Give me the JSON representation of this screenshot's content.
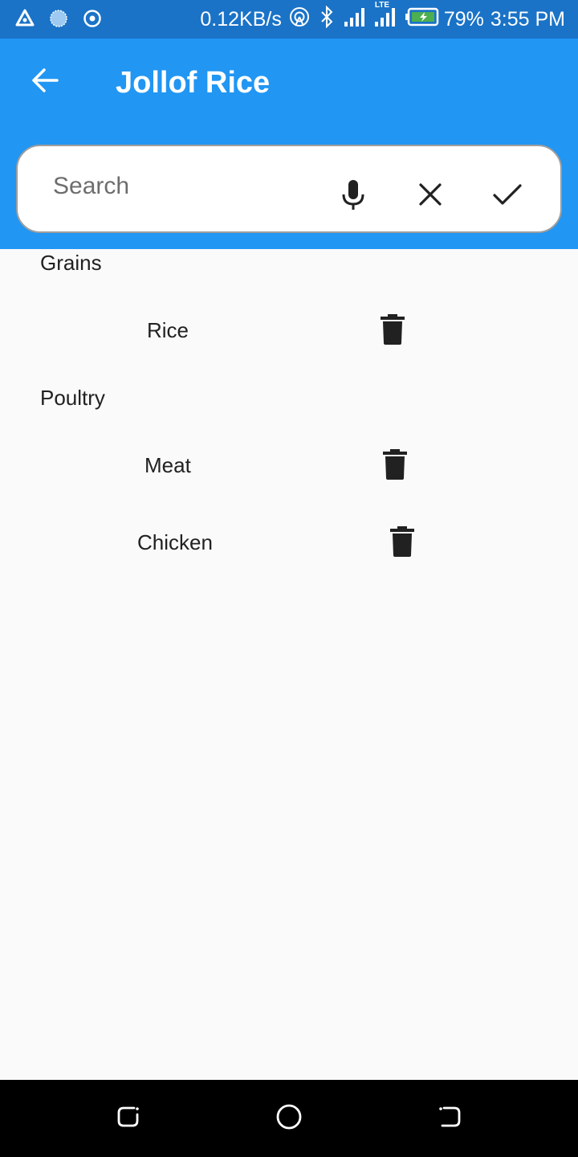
{
  "status_bar": {
    "net_speed": "0.12KB/s",
    "network_type": "LTE",
    "battery": "79%",
    "time": "3:55 PM",
    "icons": [
      "navigation-icon",
      "weather-icon",
      "radar-icon",
      "hotspot-icon",
      "bluetooth-icon",
      "signal-icon",
      "lte-signal-icon",
      "battery-charging-icon"
    ]
  },
  "app_bar": {
    "title": "Jollof Rice",
    "back_icon": "arrow-back-icon"
  },
  "search": {
    "placeholder": "Search",
    "value": "",
    "icons": [
      "mic-icon",
      "close-icon",
      "check-icon"
    ]
  },
  "categories": [
    {
      "name": "Grains",
      "items": [
        {
          "label": "Rice"
        }
      ]
    },
    {
      "name": "Poultry",
      "items": [
        {
          "label": "Meat"
        },
        {
          "label": "Chicken"
        }
      ]
    }
  ],
  "nav_bar": {
    "icons": [
      "recent-apps-icon",
      "home-icon",
      "back-nav-icon"
    ]
  },
  "colors": {
    "status_bar": "#1a73c7",
    "app_bar": "#2196f3",
    "background": "#fafafa",
    "text": "#212121"
  }
}
